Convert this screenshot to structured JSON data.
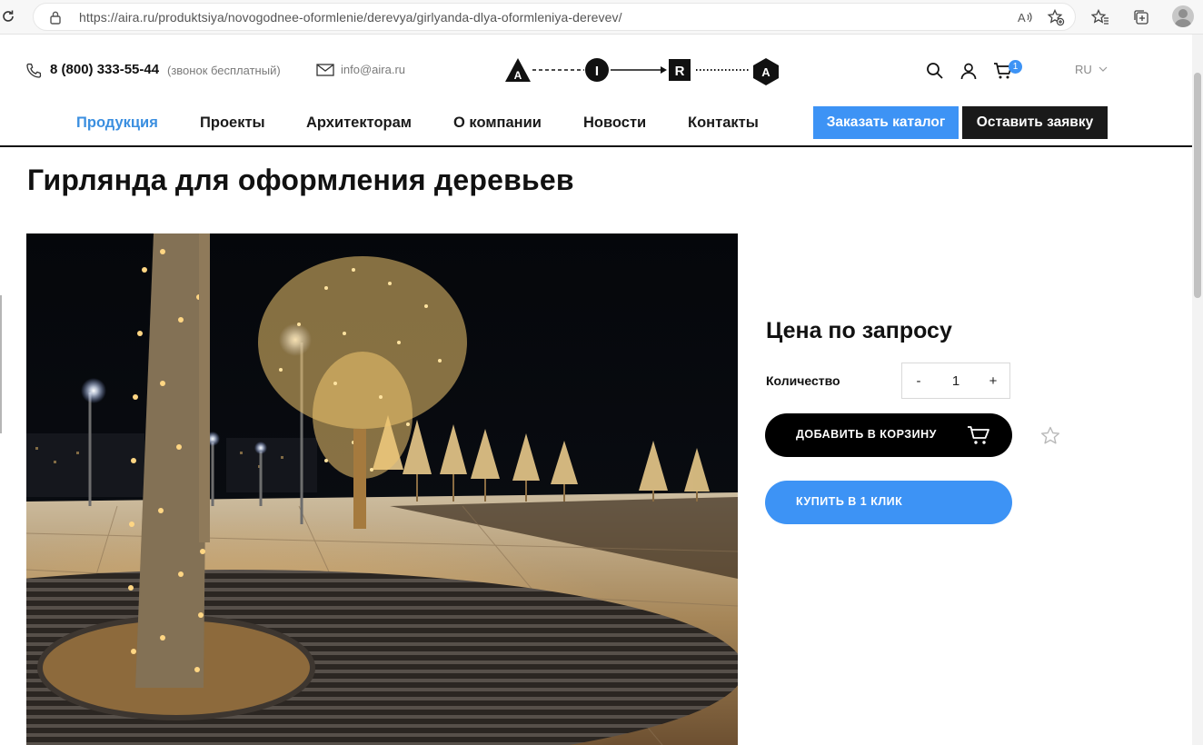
{
  "browser": {
    "url": "https://aira.ru/produktsiya/novogodnee-oformlenie/derevya/girlyanda-dlya-oformleniya-derevev/",
    "icons": [
      "reload-icon",
      "lock-icon",
      "read-aloud-icon",
      "add-favorite-icon",
      "favorites-icon",
      "collections-icon",
      "profile-avatar"
    ]
  },
  "header": {
    "phone": "8 (800) 333-55-44",
    "phone_note": "(звонок бесплатный)",
    "email": "info@aira.ru",
    "logo_letters": [
      "A",
      "I",
      "R",
      "A"
    ],
    "cart_count": "1",
    "language": "RU",
    "icons": [
      "phone-icon",
      "mail-icon",
      "search-icon",
      "user-icon",
      "cart-icon",
      "chevron-down-icon"
    ]
  },
  "nav": {
    "items": [
      "Продукция",
      "Проекты",
      "Архитекторам",
      "О компании",
      "Новости",
      "Контакты"
    ],
    "active_index": 0,
    "catalog_button": "Заказать каталог",
    "request_button": "Оставить заявку"
  },
  "product": {
    "title": "Гирлянда для оформления деревьев",
    "price": "Цена по запросу",
    "quantity_label": "Количество",
    "quantity_minus": "-",
    "quantity_value": "1",
    "quantity_plus": "+",
    "add_to_cart": "ДОБАВИТЬ В КОРЗИНУ",
    "buy_one_click": "КУПИТЬ В 1 КЛИК",
    "icons": [
      "cart-icon",
      "star-icon"
    ]
  },
  "colors": {
    "accent_blue": "#3d93f5",
    "nav_active": "#3b8fe0",
    "dark": "#1a1a1a"
  }
}
